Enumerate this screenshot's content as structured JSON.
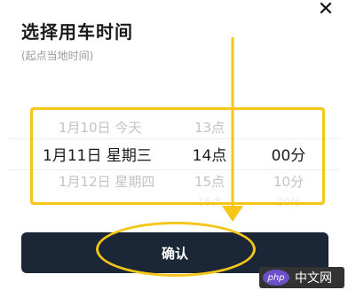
{
  "header": {
    "title": "选择用车时间",
    "subtitle": "(起点当地时间)",
    "close_icon": "close-icon"
  },
  "picker": {
    "rows": [
      {
        "date": "1月10日 今天",
        "hour": "13点",
        "minute": ""
      },
      {
        "date": "1月11日 星期三",
        "hour": "14点",
        "minute": "00分"
      },
      {
        "date": "1月12日 星期四",
        "hour": "15点",
        "minute": "10分"
      },
      {
        "date": "",
        "hour": "16点",
        "minute": "20分"
      }
    ],
    "highlight_color": "#F5C518"
  },
  "footer": {
    "confirm_label": "确认",
    "button_color": "#1b2636"
  },
  "watermark": {
    "logo": "php",
    "text": "中文网"
  }
}
